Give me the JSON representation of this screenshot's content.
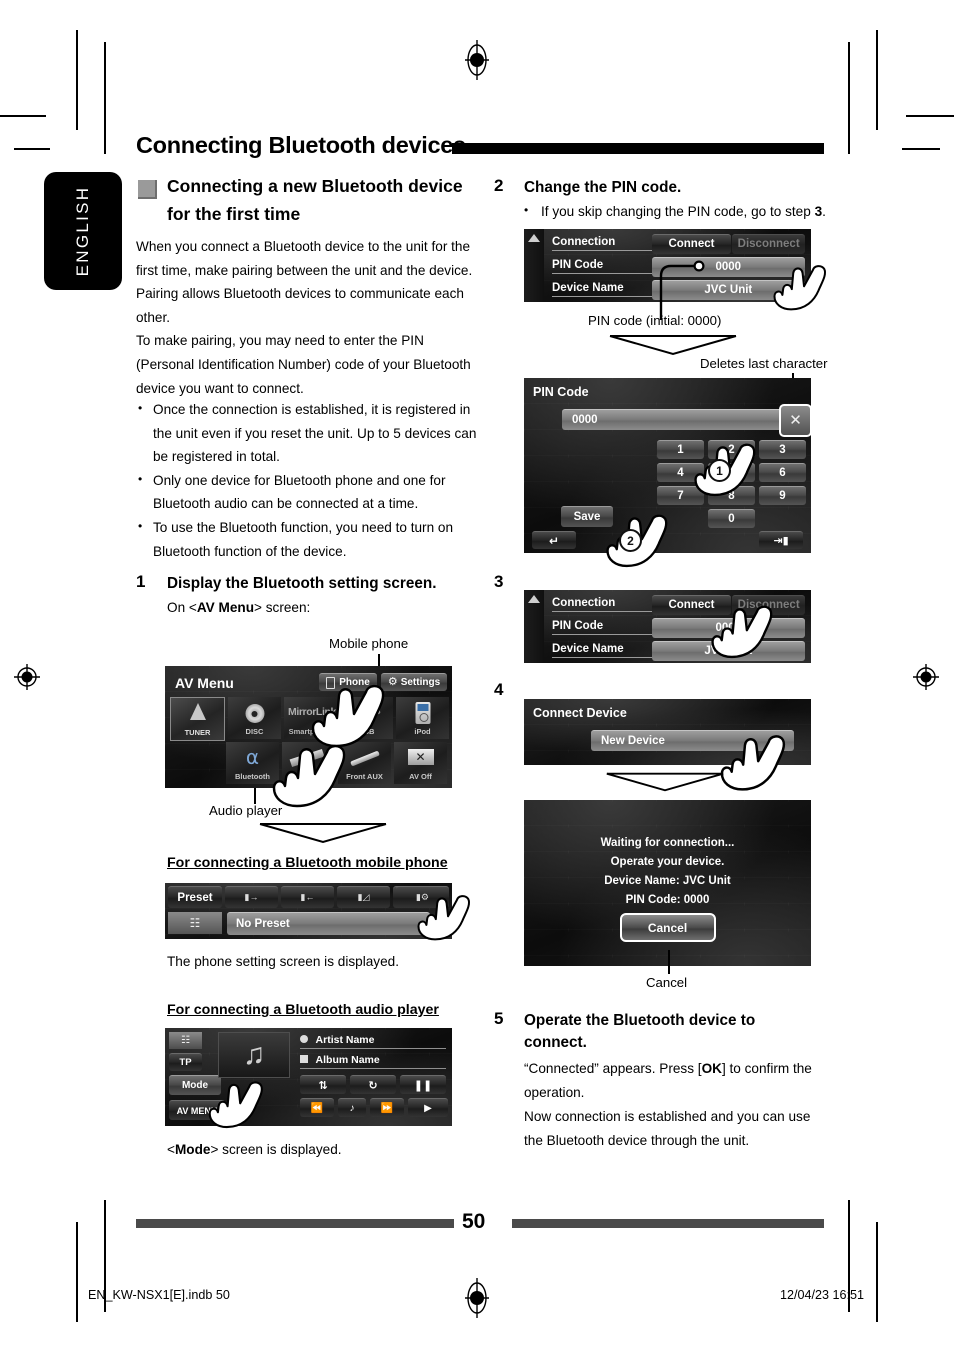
{
  "page": {
    "chapter_title": "Connecting Bluetooth devices",
    "language_tab": "ENGLISH",
    "page_number": "50",
    "file_id": "EN_KW-NSX1[E].indb   50",
    "timestamp": "12/04/23   16:51"
  },
  "section": {
    "heading_line1": "Connecting a new Bluetooth device",
    "heading_line2": "for the first time",
    "intro": "When you connect a Bluetooth device to the unit for the first time, make pairing between the unit and the device. Pairing allows Bluetooth devices to communicate each other.\nTo make pairing, you may need to enter the PIN (Personal Identification Number) code of your Bluetooth device you want to connect.",
    "bullets": [
      "Once the connection is established, it is registered in the unit even if you reset the unit. Up to 5 devices can be registered in total.",
      "Only one device for Bluetooth phone and one for Bluetooth audio can be connected at a time.",
      "To use the Bluetooth function, you need to turn on Bluetooth function of the device."
    ]
  },
  "step1": {
    "number": "1",
    "heading": "Display the Bluetooth setting screen.",
    "subtext_pre": "On <",
    "subtext_bold": "AV Menu",
    "subtext_post": "> screen:",
    "callout_top": "Mobile phone",
    "callout_bottom": "Audio player",
    "av_menu": {
      "title": "AV Menu",
      "phone_button": "Phone",
      "settings_button": "Settings",
      "sources_row1": [
        "TUNER",
        "DISC",
        "Smartphone",
        "USB",
        "iPod"
      ],
      "sources_row2": [
        "Bluetooth",
        "AV-IN",
        "Front AUX",
        "AV Off"
      ],
      "smartphone_logo": "MirrorLink"
    },
    "phone_section_heading": "For connecting a Bluetooth mobile phone",
    "phone_screen": {
      "preset_label": "Preset",
      "no_preset": "No Preset",
      "toolbar_icons": [
        "phone-out-icon",
        "phone-in-icon",
        "phone-missed-icon",
        "phonebook-icon",
        "phone-settings-icon"
      ]
    },
    "phone_result": "The phone setting screen is displayed.",
    "audio_section_heading": "For connecting a Bluetooth audio player",
    "audio_screen": {
      "tp_label": "TP",
      "mode_label": "Mode",
      "av_menu_label": "AV MENU",
      "artist": "Artist Name",
      "album": "Album Name",
      "transport_icons": [
        "shuffle-icon",
        "repeat-icon",
        "pause-icon",
        "previous-icon",
        "note-icon",
        "next-icon",
        "play-icon"
      ]
    },
    "audio_result_pre": "<",
    "audio_result_bold": "Mode",
    "audio_result_post": "> screen is displayed."
  },
  "step2": {
    "number": "2",
    "heading": "Change the PIN code.",
    "bullet_pre": "If you skip changing the PIN code, go to step ",
    "bullet_bold": "3",
    "bullet_post": ".",
    "connection_screen": {
      "rows": [
        {
          "label": "Connection",
          "value": ""
        },
        {
          "label": "PIN Code",
          "value": "0000"
        },
        {
          "label": "Device Name",
          "value": "JVC Unit"
        }
      ],
      "connect_button": "Connect",
      "disconnect_button": "Disconnect"
    },
    "callout_pin": "PIN code (initial: 0000)",
    "callout_delete": "Deletes last character",
    "pin_screen": {
      "title": "PIN Code",
      "value": "0000",
      "keys": [
        "1",
        "2",
        "3",
        "4",
        "5",
        "6",
        "7",
        "8",
        "9",
        "0"
      ],
      "save_button": "Save",
      "back_icon": "return-arrow-icon",
      "exit_icon": "exit-icon",
      "clear_icon": "clear-cross-icon",
      "marker_1": "1",
      "marker_2": "2"
    }
  },
  "step3": {
    "number": "3",
    "connection_screen": {
      "rows": [
        {
          "label": "Connection",
          "value": ""
        },
        {
          "label": "PIN Code",
          "value": "0000"
        },
        {
          "label": "Device Name",
          "value": "JVC Unit"
        }
      ],
      "connect_button": "Connect",
      "disconnect_button": "Disconnect"
    }
  },
  "step4": {
    "number": "4",
    "connect_device_screen": {
      "title": "Connect Device",
      "new_device_button": "New Device"
    },
    "waiting_screen": {
      "line1": "Waiting for connection...",
      "line2": "Operate your device.",
      "line3": "Device Name: JVC Unit",
      "line4": "PIN Code: 0000",
      "cancel_button": "Cancel"
    },
    "callout_cancel": "Cancel"
  },
  "step5": {
    "number": "5",
    "heading_line1": "Operate the Bluetooth device to",
    "heading_line2": "connect.",
    "body_pre": "“Connected” appears. Press [",
    "body_bold": "OK",
    "body_post": "] to confirm the operation.",
    "body2": "Now connection is established and you can use the Bluetooth device through the unit."
  }
}
